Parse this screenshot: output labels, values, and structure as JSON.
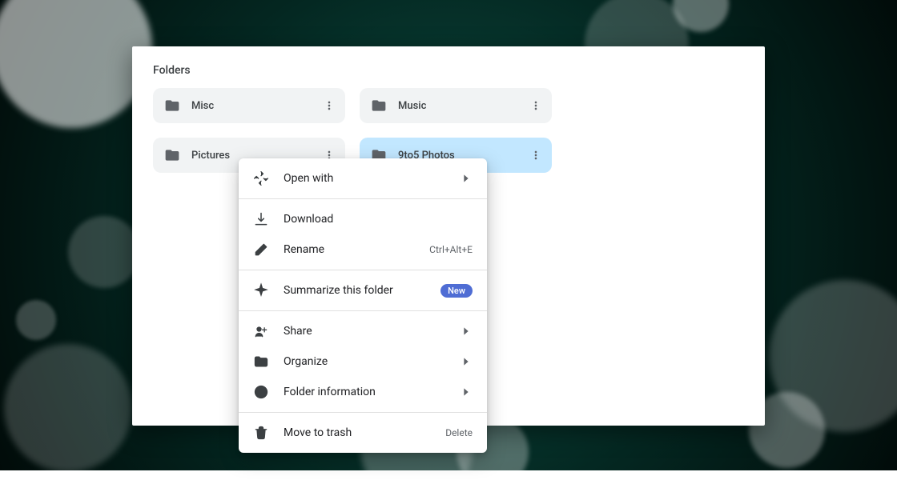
{
  "section_title": "Folders",
  "folders": [
    {
      "name": "Misc",
      "selected": false
    },
    {
      "name": "Music",
      "selected": false
    },
    {
      "name": "Pictures",
      "selected": false
    },
    {
      "name": "9to5 Photos",
      "selected": true
    }
  ],
  "context_menu": {
    "open_with": "Open with",
    "download": "Download",
    "rename": "Rename",
    "rename_shortcut": "Ctrl+Alt+E",
    "summarize": "Summarize this folder",
    "summarize_badge": "New",
    "share": "Share",
    "organize": "Organize",
    "folder_info": "Folder information",
    "move_to_trash": "Move to trash",
    "trash_shortcut": "Delete"
  }
}
